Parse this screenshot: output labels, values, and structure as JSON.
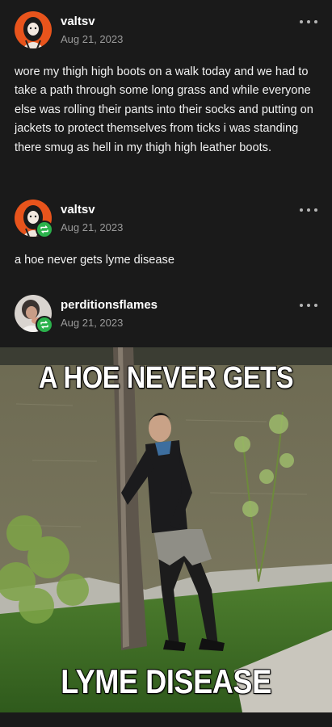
{
  "posts": [
    {
      "username": "valtsv",
      "date": "Aug 21, 2023",
      "text": "wore my thigh high boots on a walk today and we had to take a path through some long grass and while everyone else was rolling their pants into their socks and putting on jackets to protect themselves from ticks i was standing there smug as hell in my thigh high leather boots."
    },
    {
      "username": "valtsv",
      "date": "Aug 21, 2023",
      "text": "a hoe never gets lyme disease",
      "reblog_icon": "reblog-icon"
    },
    {
      "username": "perditionsflames",
      "date": "Aug 21, 2023",
      "reblog_icon": "reblog-icon"
    }
  ],
  "meme": {
    "top_text": "A HOE NEVER GETS",
    "bottom_text": "LYME DISEASE"
  },
  "colors": {
    "background": "#1a1a1a",
    "username": "#ffffff",
    "date": "#9b9b9b",
    "reblog_badge": "#2bb24c",
    "avatar_orange": "#e8541c"
  }
}
